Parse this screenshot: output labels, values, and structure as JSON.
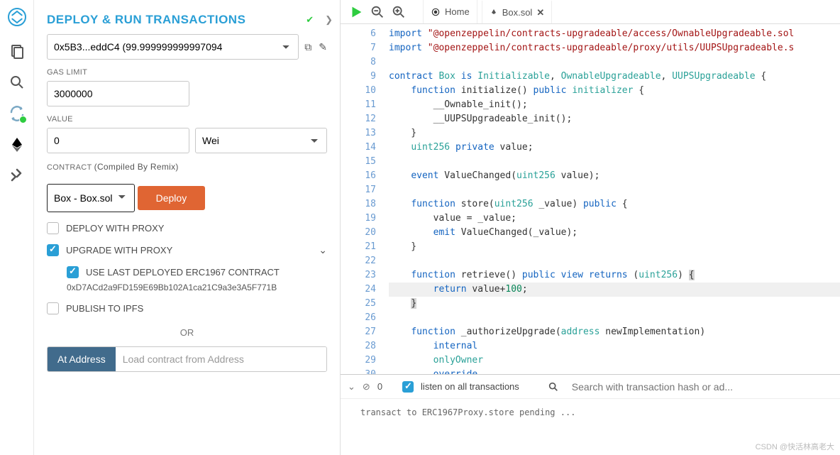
{
  "panel": {
    "title": "DEPLOY & RUN TRANSACTIONS",
    "account": "0x5B3...eddC4 (99.999999999997094",
    "gasLimitLabel": "GAS LIMIT",
    "gasLimit": "3000000",
    "valueLabel": "VALUE",
    "value": "0",
    "valueUnit": "Wei",
    "contractLabel": "CONTRACT",
    "contractNote": "(Compiled By Remix)",
    "contract": "Box - Box.sol",
    "deployLabel": "Deploy",
    "deployProxy": "DEPLOY WITH PROXY",
    "upgradeProxy": "UPGRADE WITH PROXY",
    "useLast": "USE LAST DEPLOYED ERC1967 CONTRACT",
    "lastAddr": "0xD7ACd2a9FD159E69Bb102A1ca21C9a3e3A5F771B",
    "publishIpfs": "PUBLISH TO IPFS",
    "or": "OR",
    "atAddress": "At Address",
    "atPlaceholder": "Load contract from Address"
  },
  "tabs": {
    "home": "Home",
    "file": "Box.sol"
  },
  "code": {
    "lines": [
      6,
      7,
      8,
      9,
      10,
      11,
      12,
      13,
      14,
      15,
      16,
      17,
      18,
      19,
      20,
      21,
      22,
      23,
      24,
      25,
      26,
      27,
      28,
      29,
      30
    ]
  },
  "console": {
    "count": "0",
    "listen": "listen on all transactions",
    "searchPlaceholder": "Search with transaction hash or ad...",
    "log": "transact to ERC1967Proxy.store pending ..."
  },
  "watermark": "CSDN @快活林高老大"
}
